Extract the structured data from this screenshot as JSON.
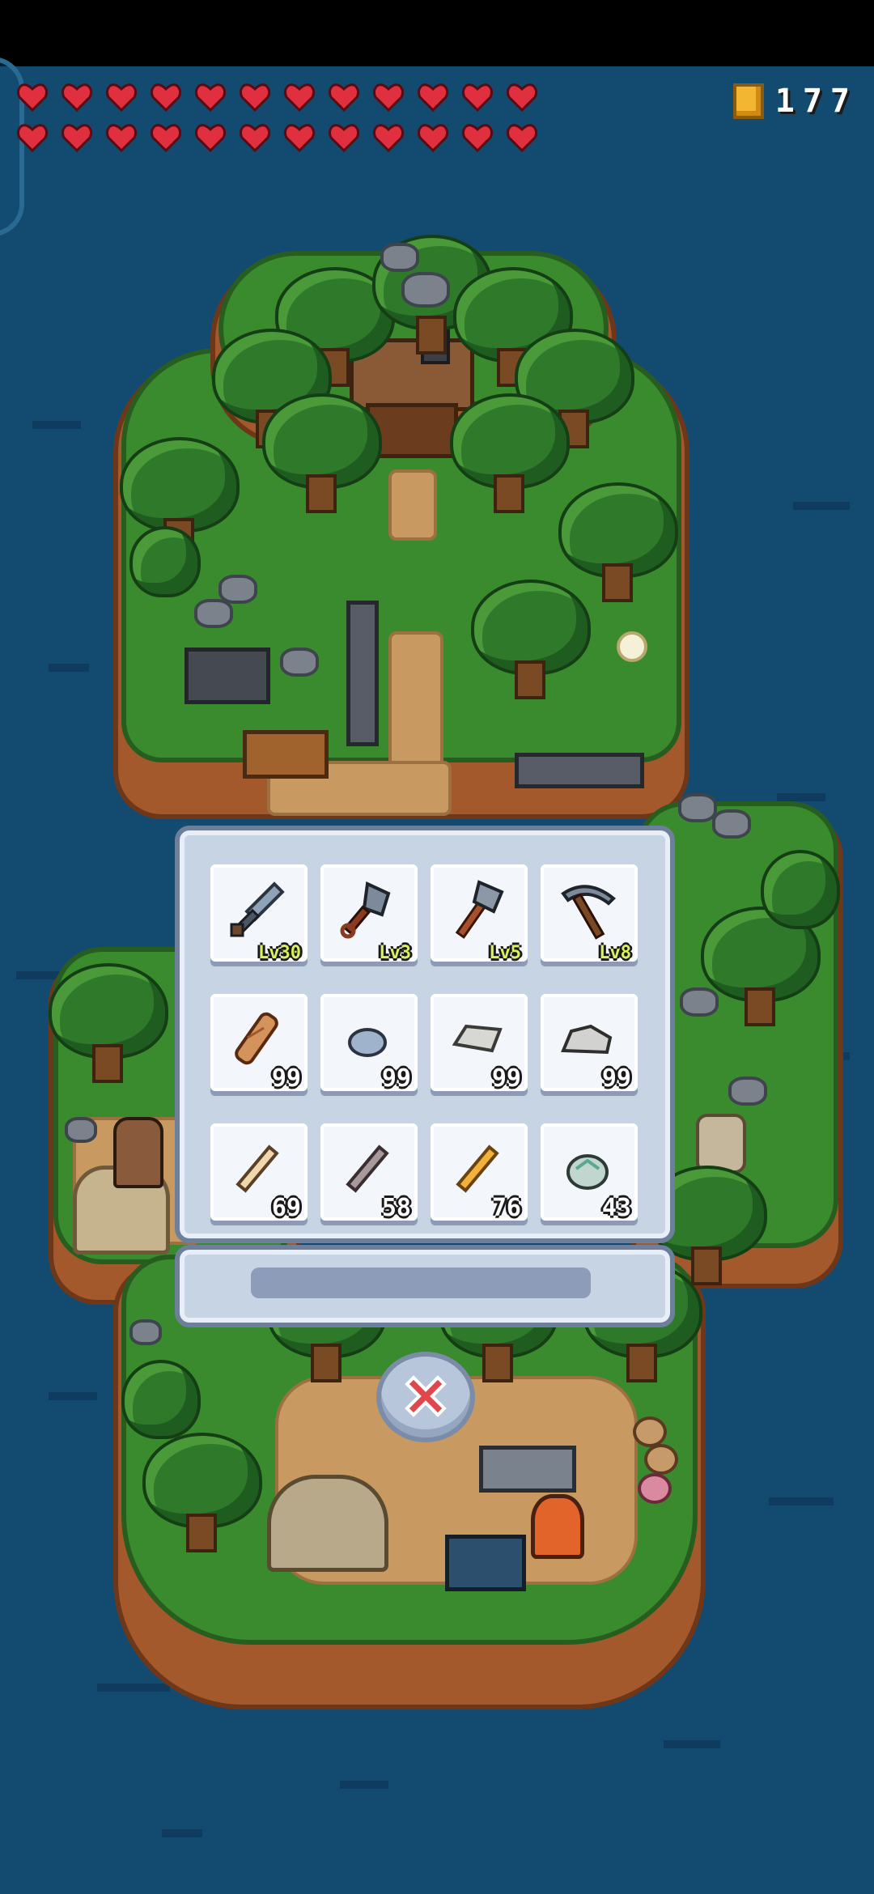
{
  "hud": {
    "hearts_row1": 12,
    "hearts_row2": 12,
    "coins": "177",
    "colors": {
      "heart": "#e03040",
      "coin": "#f2b632"
    }
  },
  "inventory": {
    "tools": [
      {
        "name": "sword",
        "badge": "Lv30"
      },
      {
        "name": "shovel",
        "badge": "Lv3"
      },
      {
        "name": "axe",
        "badge": "Lv5"
      },
      {
        "name": "pickaxe",
        "badge": "Lv8"
      }
    ],
    "materials": [
      {
        "name": "wood-log",
        "count": "99"
      },
      {
        "name": "stone",
        "count": "99"
      },
      {
        "name": "iron-ingot",
        "count": "99"
      },
      {
        "name": "rock-ore",
        "count": "99"
      }
    ],
    "drops": [
      {
        "name": "bone",
        "count": "69"
      },
      {
        "name": "dark-bone",
        "count": "58"
      },
      {
        "name": "gold-bone",
        "count": "76"
      },
      {
        "name": "crystal-ore",
        "count": "43"
      }
    ],
    "progress_fraction": 0.0
  },
  "close_button": {
    "icon": "close-icon"
  }
}
